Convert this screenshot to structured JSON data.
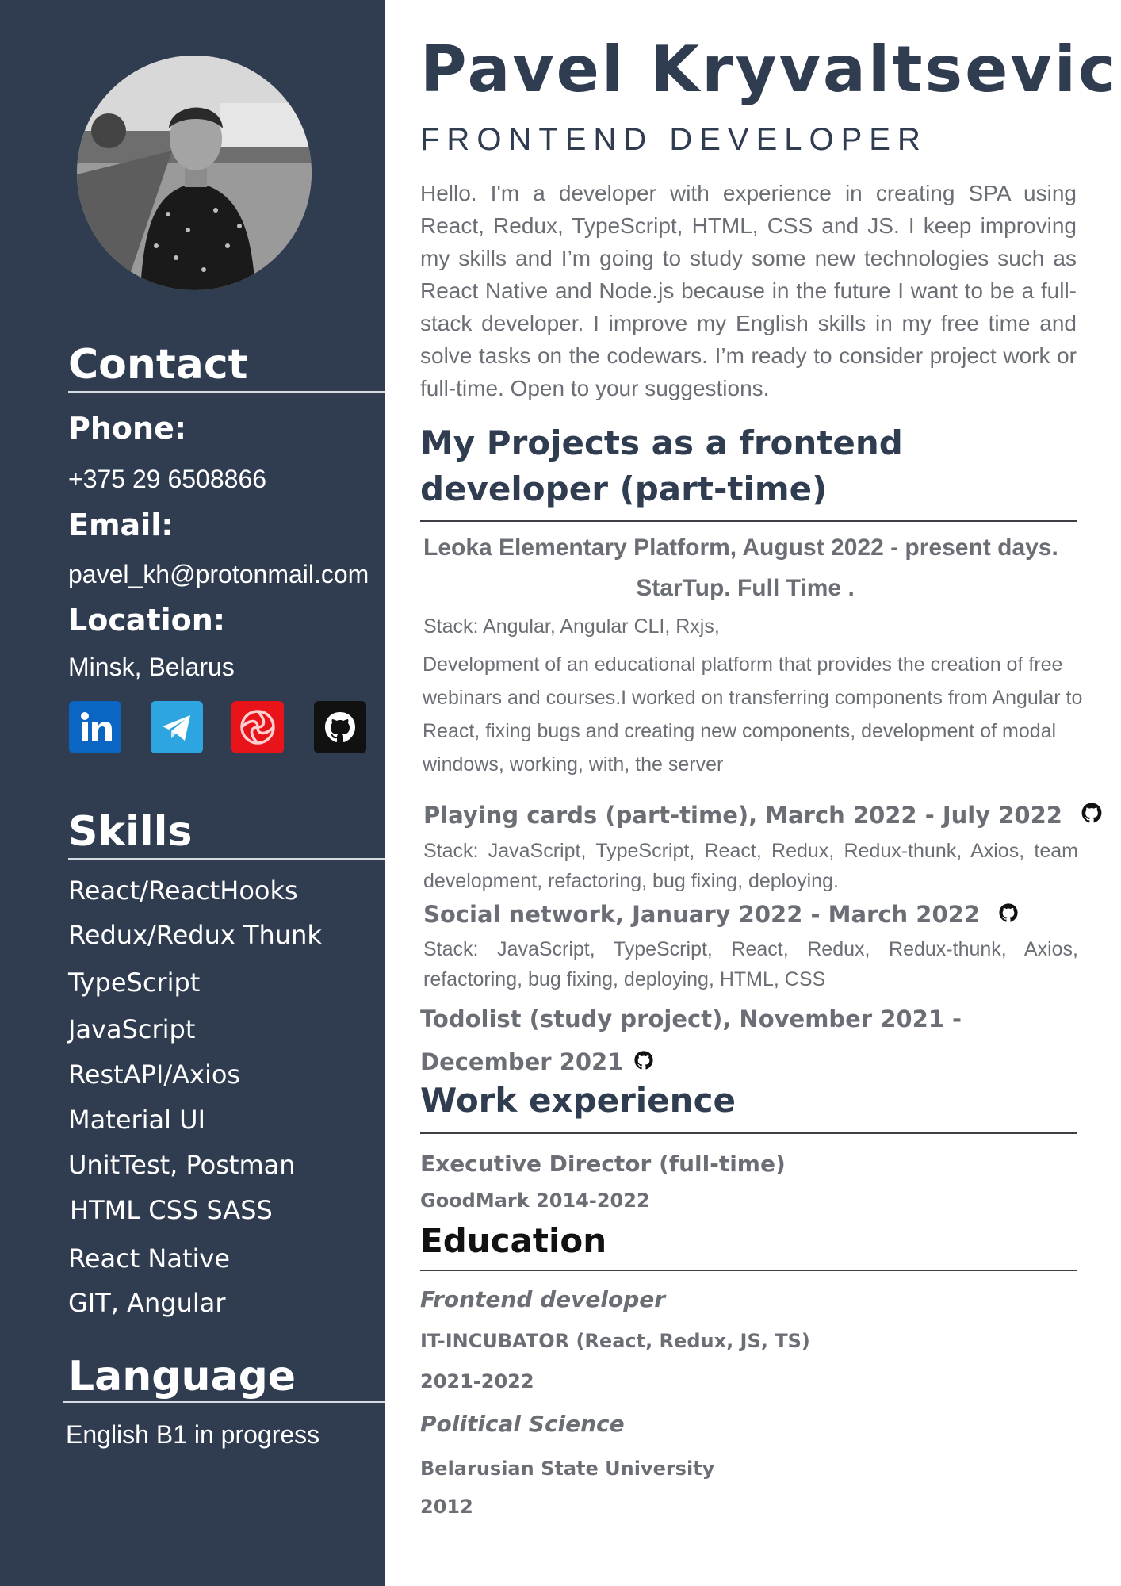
{
  "header": {
    "name": "Pavel Kryvaltsevich",
    "role": "FRONTEND DEVELOPER",
    "intro": "Hello. I'm a developer with experience in creating SPA using React, Redux, TypeScript, HTML, CSS and JS.  I keep improving my skills and I’m going to study some new technologies such as React Native and Node.js  because in the future I want to be a full-stack developer. I improve my English skills in my free time and solve tasks on the codewars. I’m ready to consider project work or full-time. Open to your suggestions."
  },
  "sidebar": {
    "contact": {
      "title": "Contact",
      "phone_label": "Phone:",
      "phone": "+375 29 6508866",
      "email_label": "Email:",
      "email": "pavel_kh@protonmail.com",
      "location_label": "Location:",
      "location": "Minsk, Belarus"
    },
    "social": [
      {
        "icon": "linkedin-icon",
        "color": "#0a66c2"
      },
      {
        "icon": "telegram-icon",
        "color": "#2ca5e0"
      },
      {
        "icon": "codewars-icon",
        "color": "#e8141a"
      },
      {
        "icon": "github-icon",
        "color": "#111111"
      }
    ],
    "skills": {
      "title": "Skills",
      "items": [
        "React/ReactHooks",
        "Redux/Redux Thunk",
        "TypeScript",
        "JavaScript",
        "RestAPI/Axios",
        "Material UI",
        "UnitTest, Postman",
        "HTML CSS SASS",
        "React Native",
        "GIT, Angular"
      ]
    },
    "language": {
      "title": "Language",
      "value": "English B1 in progress"
    }
  },
  "projects": {
    "title": "My Projects as a frontend developer (part-time)",
    "leoka": {
      "title": "Leoka Elementary Platform,  August 2022 - present days.",
      "subtitle": "StarTup. Full Time .",
      "stack": "Stack: Angular, Angular CLI, Rxjs,",
      "description": "Development of an educational platform that provides the creation of free webinars and courses.I worked on transferring components from Angular to React, fixing bugs and creating new components, development of modal windows, working, with, the server"
    },
    "cards": {
      "title": "Playing cards (part-time), March 2022 - July 2022",
      "stack": "Stack: JavaScript, TypeScript, React, Redux, Redux-thunk, Axios, team development, refactoring, bug fixing, deploying."
    },
    "social": {
      "title": "Social network, January 2022 - March 2022",
      "stack": "Stack: JavaScript, TypeScript, React, Redux, Redux-thunk, Axios, refactoring, bug fixing, deploying, HTML, CSS"
    },
    "todolist": {
      "title": "Todolist (study project), November 2021 - December 2021"
    }
  },
  "work": {
    "title": "Work experience",
    "position": "Executive Director (full-time)",
    "company": "GoodMark 2014-2022"
  },
  "education": {
    "title": "Education",
    "items": [
      {
        "degree": "Frontend developer",
        "school": "IT-INCUBATOR (React, Redux, JS, TS)",
        "years": "2021-2022"
      },
      {
        "degree": "Political Science",
        "school": "Belarusian State University",
        "years": "2012"
      }
    ]
  },
  "colors": {
    "sidebar": "#303c50",
    "heading": "#303c50",
    "body_text": "#6b6f75"
  }
}
